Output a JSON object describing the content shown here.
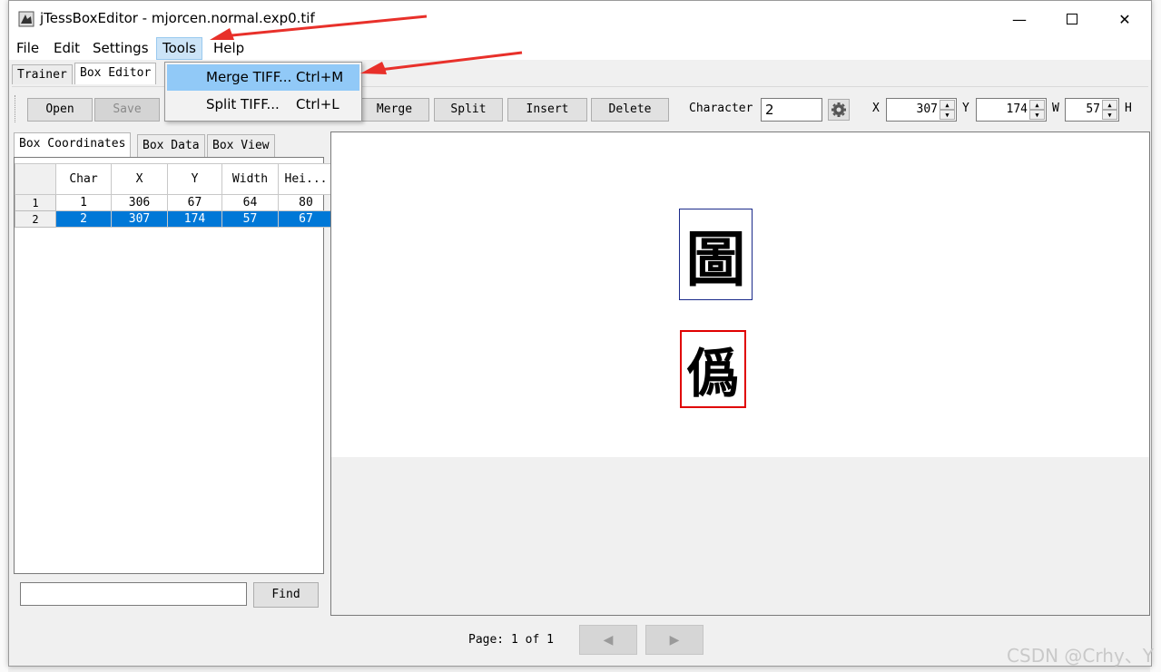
{
  "window": {
    "title": "jTessBoxEditor - mjorcen.normal.exp0.tif"
  },
  "menubar": {
    "items": [
      "File",
      "Edit",
      "Settings",
      "Tools",
      "Help"
    ]
  },
  "tools_menu": {
    "items": [
      {
        "label": "Merge TIFF...",
        "shortcut": "Ctrl+M"
      },
      {
        "label": "Split TIFF...",
        "shortcut": "Ctrl+L"
      }
    ]
  },
  "main_tabs": [
    "Trainer",
    "Box Editor"
  ],
  "toolbar": {
    "open": "Open",
    "save": "Save",
    "merge": "Merge",
    "split": "Split",
    "insert": "Insert",
    "delete": "Delete",
    "character_label": "Character",
    "character_value": "2",
    "x_label": "X",
    "x_value": "307",
    "y_label": "Y",
    "y_value": "174",
    "w_label": "W",
    "w_value": "57",
    "h_label": "H"
  },
  "left_tabs": [
    "Box Coordinates",
    "Box Data",
    "Box View"
  ],
  "table": {
    "headers": [
      "Char",
      "X",
      "Y",
      "Width",
      "Hei..."
    ],
    "rows": [
      {
        "num": "1",
        "cells": [
          "1",
          "306",
          "67",
          "64",
          "80"
        ]
      },
      {
        "num": "2",
        "cells": [
          "2",
          "307",
          "174",
          "57",
          "67"
        ]
      }
    ]
  },
  "find": {
    "value": "",
    "button": "Find"
  },
  "image": {
    "glyph_1": "圖",
    "glyph_2": "僞"
  },
  "pager": {
    "label": "Page: 1 of 1"
  },
  "watermark": "CSDN @Crhy、Y",
  "colors": {
    "selection": "#0078d7",
    "menu_highlight": "#91c9f7",
    "box_selected": "#e00000",
    "box_normal": "#1a2a8a",
    "arrow": "#e8302a"
  }
}
